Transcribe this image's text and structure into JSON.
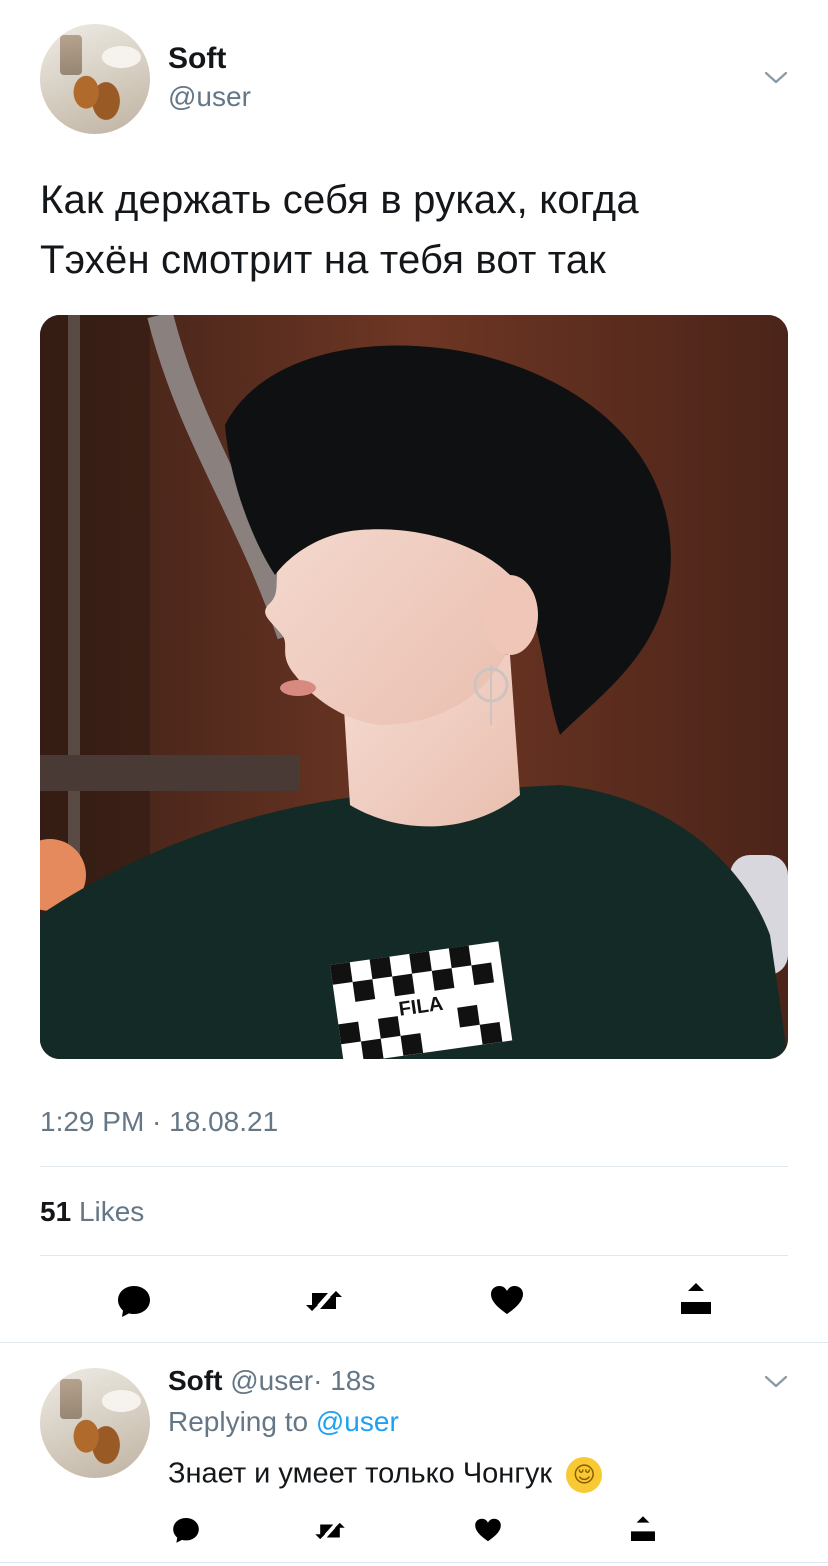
{
  "tweet": {
    "display_name": "Soft",
    "handle": "@user",
    "text_line1": "Как держать себя в руках, когда",
    "text_line2": "Тэхён смотрит на тебя вот так",
    "timestamp": "1:29 PM · 18.08.21",
    "likes_count": "51",
    "likes_label": "Likes",
    "photo_logo_text": "FILA"
  },
  "reply": {
    "display_name": "Soft",
    "handle": "@user",
    "age": "· 18s",
    "replying_prefix": "Replying to",
    "replying_handle": "@user",
    "text": "Знает и умеет только Чонгук",
    "emoji": "😌"
  },
  "colors": {
    "text": "#14171a",
    "muted": "#657786",
    "accent": "#1da1f2",
    "divider": "#e1e8ed"
  },
  "icons": [
    "chevron-down-icon",
    "reply-icon",
    "retweet-icon",
    "like-icon",
    "share-icon"
  ]
}
